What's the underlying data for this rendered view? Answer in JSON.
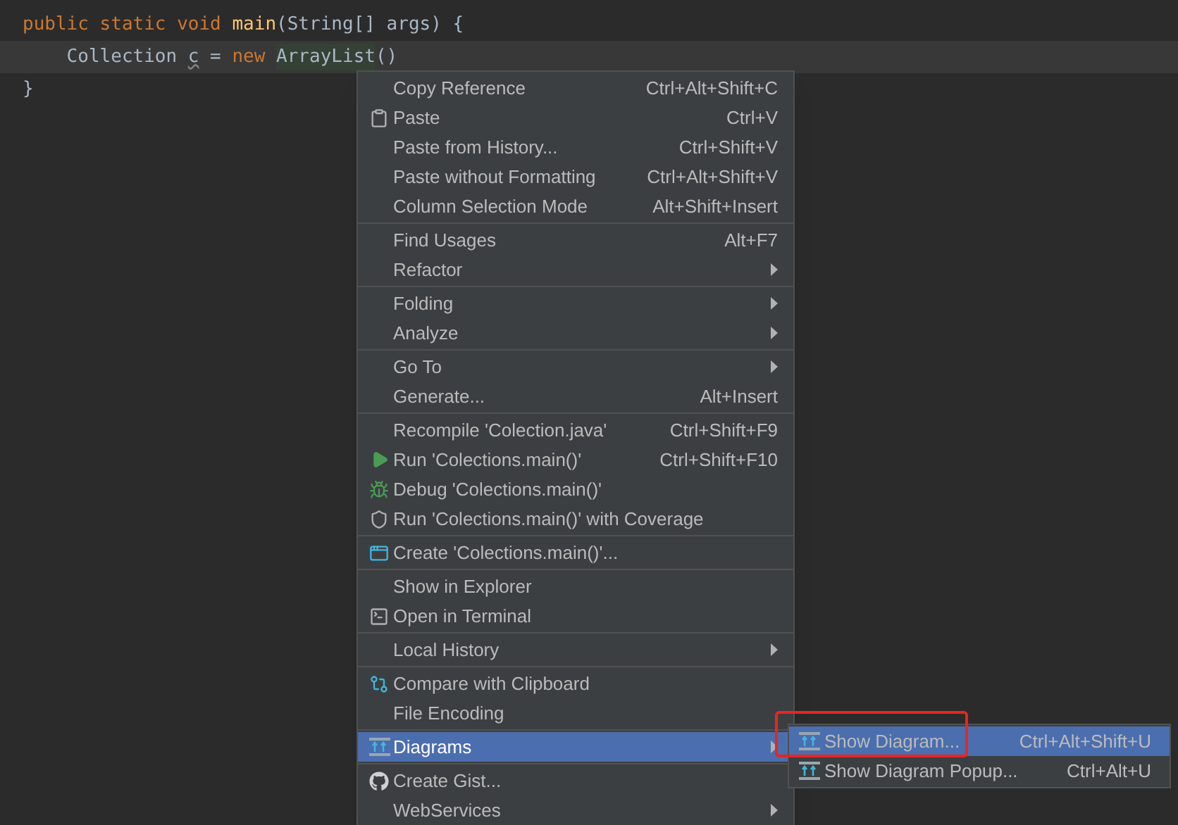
{
  "code": {
    "lines": [
      {
        "tokens": [
          {
            "text": "public static void ",
            "kind": "keyword"
          },
          {
            "text": "main",
            "kind": "method"
          },
          {
            "text": "(String[] args) {",
            "kind": "plain"
          }
        ],
        "current": false
      },
      {
        "tokens": [
          {
            "text": "    Collection ",
            "kind": "plain"
          },
          {
            "text": "c",
            "kind": "unused"
          },
          {
            "text": " = ",
            "kind": "plain"
          },
          {
            "text": "new ",
            "kind": "keyword"
          },
          {
            "text": "ArrayList",
            "kind": "match"
          },
          {
            "text": "()",
            "kind": "plain"
          }
        ],
        "current": true
      },
      {
        "tokens": [
          {
            "text": "}",
            "kind": "plain"
          }
        ],
        "current": false
      }
    ]
  },
  "context_menu": {
    "groups": [
      [
        {
          "label": "Copy Reference",
          "shortcut": "Ctrl+Alt+Shift+C",
          "kind": "plain",
          "submenu": false,
          "selected": false
        },
        {
          "label": "Paste",
          "shortcut": "Ctrl+V",
          "kind": "paste",
          "submenu": false,
          "selected": false
        },
        {
          "label": "Paste from History...",
          "shortcut": "Ctrl+Shift+V",
          "kind": "plain",
          "submenu": false,
          "selected": false
        },
        {
          "label": "Paste without Formatting",
          "shortcut": "Ctrl+Alt+Shift+V",
          "kind": "plain",
          "submenu": false,
          "selected": false
        },
        {
          "label": "Column Selection Mode",
          "shortcut": "Alt+Shift+Insert",
          "kind": "plain",
          "submenu": false,
          "selected": false
        }
      ],
      [
        {
          "label": "Find Usages",
          "shortcut": "Alt+F7",
          "kind": "plain",
          "submenu": false,
          "selected": false
        },
        {
          "label": "Refactor",
          "kind": "plain",
          "submenu": true,
          "selected": false
        }
      ],
      [
        {
          "label": "Folding",
          "kind": "plain",
          "submenu": true,
          "selected": false
        },
        {
          "label": "Analyze",
          "kind": "plain",
          "submenu": true,
          "selected": false
        }
      ],
      [
        {
          "label": "Go To",
          "kind": "plain",
          "submenu": true,
          "selected": false
        },
        {
          "label": "Generate...",
          "shortcut": "Alt+Insert",
          "kind": "plain",
          "submenu": false,
          "selected": false
        }
      ],
      [
        {
          "label": "Recompile 'Colection.java'",
          "shortcut": "Ctrl+Shift+F9",
          "kind": "plain",
          "submenu": false,
          "selected": false
        },
        {
          "label": "Run 'Colections.main()'",
          "shortcut": "Ctrl+Shift+F10",
          "kind": "run",
          "submenu": false,
          "selected": false
        },
        {
          "label": "Debug 'Colections.main()'",
          "kind": "debug",
          "submenu": false,
          "selected": false
        },
        {
          "label": "Run 'Colections.main()' with Coverage",
          "kind": "coverage",
          "submenu": false,
          "selected": false
        }
      ],
      [
        {
          "label": "Create 'Colections.main()'...",
          "kind": "create",
          "submenu": false,
          "selected": false
        }
      ],
      [
        {
          "label": "Show in Explorer",
          "kind": "plain",
          "submenu": false,
          "selected": false
        },
        {
          "label": "Open in Terminal",
          "kind": "terminal",
          "submenu": false,
          "selected": false
        }
      ],
      [
        {
          "label": "Local History",
          "kind": "plain",
          "submenu": true,
          "selected": false
        }
      ],
      [
        {
          "label": "Compare with Clipboard",
          "kind": "compare",
          "submenu": false,
          "selected": false
        },
        {
          "label": "File Encoding",
          "kind": "plain",
          "submenu": false,
          "selected": false
        }
      ],
      [
        {
          "label": "Diagrams",
          "kind": "diagram",
          "submenu": true,
          "selected": true
        }
      ],
      [
        {
          "label": "Create Gist...",
          "kind": "gist",
          "submenu": false,
          "selected": false
        },
        {
          "label": "WebServices",
          "kind": "plain",
          "submenu": true,
          "selected": false
        }
      ]
    ]
  },
  "submenu": {
    "items": [
      {
        "label": "Show Diagram...",
        "shortcut": "Ctrl+Alt+Shift+U",
        "selected": true,
        "annotated": true
      },
      {
        "label": "Show Diagram Popup...",
        "shortcut": "Ctrl+Alt+U",
        "selected": false,
        "annotated": false
      }
    ]
  }
}
